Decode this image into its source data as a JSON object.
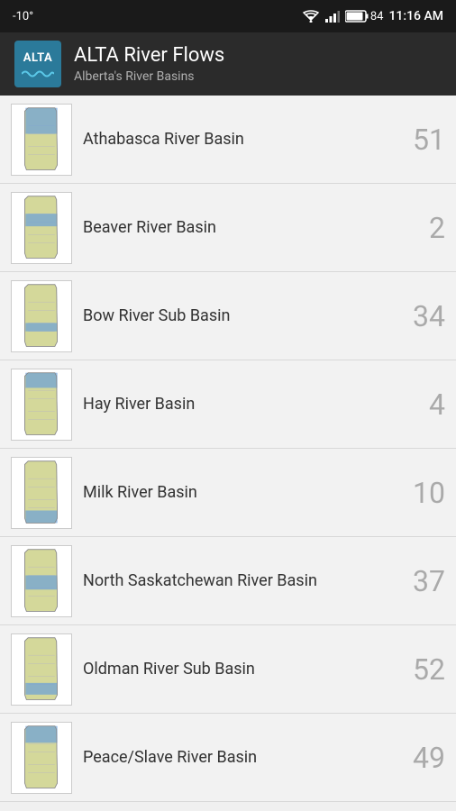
{
  "statusBar": {
    "temperature": "-10°",
    "time": "11:16 AM",
    "battery": "84"
  },
  "toolbar": {
    "appName": "ALTA River Flows",
    "subtitle": "Alberta's River Basins",
    "logoText": "ALTA"
  },
  "basins": [
    {
      "name": "Athabasca River Basin",
      "count": "51",
      "id": "athabasca"
    },
    {
      "name": "Beaver River Basin",
      "count": "2",
      "id": "beaver"
    },
    {
      "name": "Bow River Sub Basin",
      "count": "34",
      "id": "bow"
    },
    {
      "name": "Hay River Basin",
      "count": "4",
      "id": "hay"
    },
    {
      "name": "Milk River Basin",
      "count": "10",
      "id": "milk"
    },
    {
      "name": "North Saskatchewan River Basin",
      "count": "37",
      "id": "north-sask"
    },
    {
      "name": "Oldman River Sub Basin",
      "count": "52",
      "id": "oldman"
    },
    {
      "name": "Peace/Slave River Basin",
      "count": "49",
      "id": "peace"
    }
  ]
}
